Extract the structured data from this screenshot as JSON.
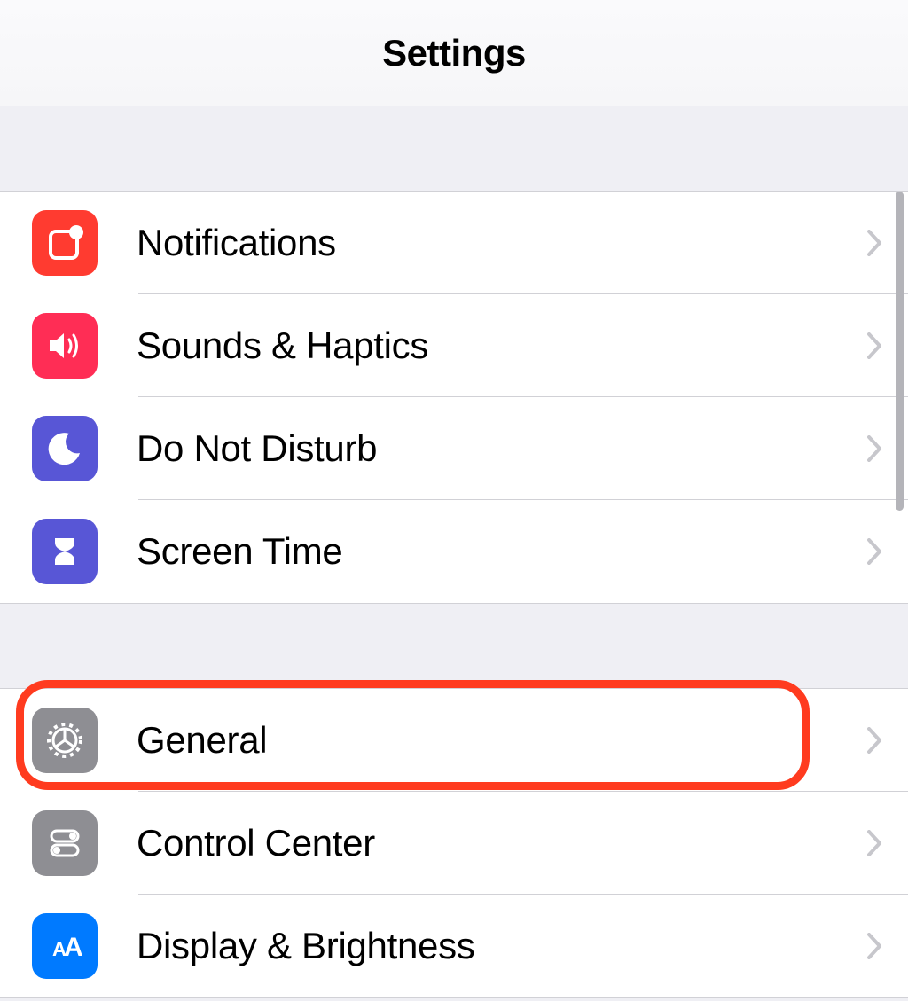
{
  "header": {
    "title": "Settings"
  },
  "group1": {
    "items": [
      {
        "label": "Notifications",
        "icon": "notifications-icon",
        "color": "bg-red"
      },
      {
        "label": "Sounds & Haptics",
        "icon": "speaker-icon",
        "color": "bg-pink"
      },
      {
        "label": "Do Not Disturb",
        "icon": "moon-icon",
        "color": "bg-purple"
      },
      {
        "label": "Screen Time",
        "icon": "hourglass-icon",
        "color": "bg-purple"
      }
    ]
  },
  "group2": {
    "items": [
      {
        "label": "General",
        "icon": "gear-icon",
        "color": "bg-gray",
        "highlighted": true
      },
      {
        "label": "Control Center",
        "icon": "toggles-icon",
        "color": "bg-gray"
      },
      {
        "label": "Display & Brightness",
        "icon": "text-size-icon",
        "color": "bg-blue"
      }
    ]
  }
}
